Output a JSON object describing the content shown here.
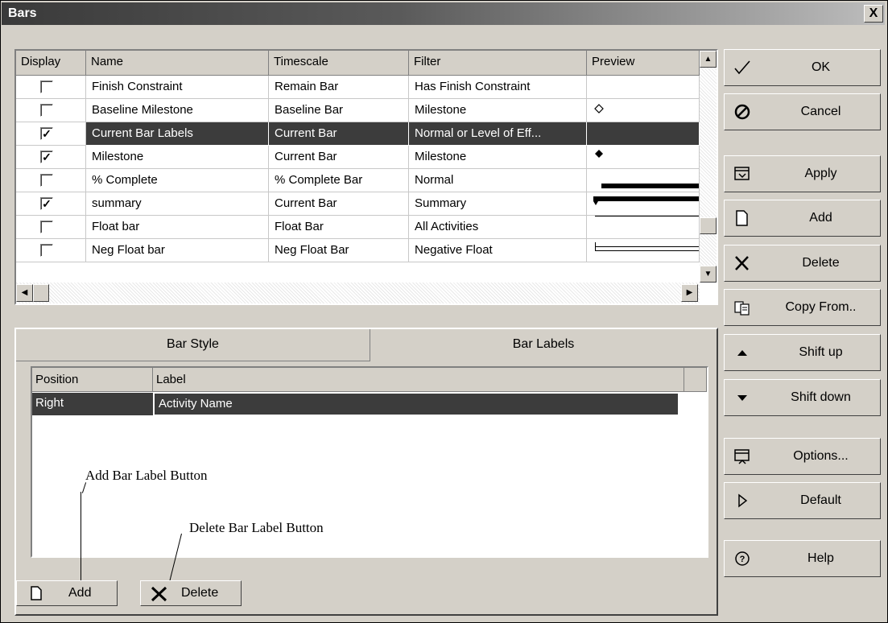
{
  "window": {
    "title": "Bars",
    "close_label": "X"
  },
  "bars_grid": {
    "columns": [
      "Display",
      "Name",
      "Timescale",
      "Filter",
      "Preview"
    ],
    "rows": [
      {
        "display": "",
        "name": "Finish Constraint",
        "timescale": "Remain Bar",
        "filter": "Has Finish Constraint",
        "preview": "none",
        "selected": false
      },
      {
        "display": "",
        "name": "Baseline Milestone",
        "timescale": "Baseline Bar",
        "filter": "Milestone",
        "preview": "hollow-diamond",
        "selected": false
      },
      {
        "display": "✓",
        "name": "Current Bar Labels",
        "timescale": "Current Bar",
        "filter": "Normal or Level of Eff...",
        "preview": "none",
        "selected": true
      },
      {
        "display": "✓",
        "name": "Milestone",
        "timescale": "Current Bar",
        "filter": "Milestone",
        "preview": "solid-diamond",
        "selected": false
      },
      {
        "display": "",
        "name": "% Complete",
        "timescale": "% Complete Bar",
        "filter": "Normal",
        "preview": "thick-bar",
        "selected": false
      },
      {
        "display": "✓",
        "name": "summary",
        "timescale": "Current Bar",
        "filter": "Summary",
        "preview": "summary-bar",
        "selected": false
      },
      {
        "display": "",
        "name": "Float bar",
        "timescale": "Float Bar",
        "filter": "All Activities",
        "preview": "thin-bar",
        "selected": false
      },
      {
        "display": "",
        "name": "Neg Float bar",
        "timescale": "Neg Float Bar",
        "filter": "Negative Float",
        "preview": "hollow-bar",
        "selected": false
      }
    ]
  },
  "tabs": {
    "bar_style": "Bar Style",
    "bar_labels": "Bar Labels"
  },
  "labels_list": {
    "columns": [
      "Position",
      "Label"
    ],
    "rows": [
      {
        "position": "Right",
        "label": "Activity Name"
      }
    ]
  },
  "annotations": {
    "add": "Add Bar Label Button",
    "delete": "Delete Bar Label Button"
  },
  "panel_buttons": {
    "add": "Add",
    "delete": "Delete"
  },
  "side_buttons": [
    {
      "label": "OK",
      "icon": "check-icon"
    },
    {
      "label": "Cancel",
      "icon": "cancel-icon"
    },
    {
      "label": "Apply",
      "icon": "apply-icon"
    },
    {
      "label": "Add",
      "icon": "new-document-icon"
    },
    {
      "label": "Delete",
      "icon": "delete-x-icon"
    },
    {
      "label": "Copy From..",
      "icon": "copy-icon"
    },
    {
      "label": "Shift up",
      "icon": "triangle-up-icon"
    },
    {
      "label": "Shift down",
      "icon": "triangle-down-icon"
    },
    {
      "label": "Options...",
      "icon": "options-icon"
    },
    {
      "label": "Default",
      "icon": "triangle-right-icon"
    },
    {
      "label": "Help",
      "icon": "help-icon"
    }
  ]
}
